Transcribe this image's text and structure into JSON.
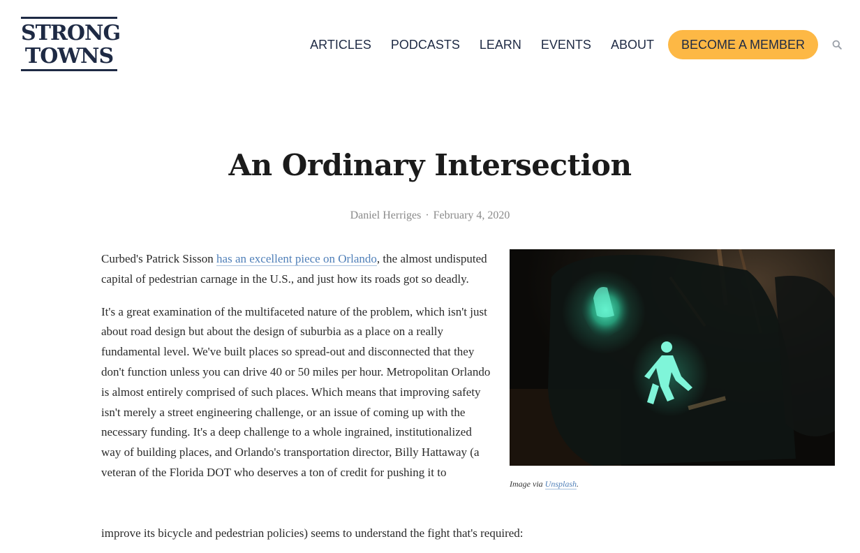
{
  "logo": {
    "line1": "STRONG",
    "line2": "TOWNS"
  },
  "nav": {
    "items": [
      "ARTICLES",
      "PODCASTS",
      "LEARN",
      "EVENTS",
      "ABOUT"
    ],
    "cta": "BECOME A MEMBER",
    "search_icon": "search-icon",
    "cta_color": "#fdb845",
    "brand_color": "#1e2a44"
  },
  "article": {
    "title": "An Ordinary Intersection",
    "author": "Daniel Herriges",
    "separator": "·",
    "date": "February 4, 2020",
    "para1_prefix": "Curbed's Patrick Sisson ",
    "para1_link": "has an excellent piece on Orlando",
    "para1_suffix": ", the almost undisputed capital of pedestrian carnage in the U.S., and just how its roads got so deadly.",
    "para2": "It's a great examination of the multifaceted nature of the problem, which isn't just about road design but about the design of suburbia as a place on a really fundamental level. We've built places so spread-out and disconnected that they don't function unless you can drive 40 or 50 miles per hour. Metropolitan Orlando is almost entirely comprised of such places. Which means that improving safety isn't merely a street engineering challenge, or an issue of coming up with the necessary funding. It's a deep challenge to a whole ingrained, institutionalized way of building places, and Orlando's transportation director, Billy Hattaway (a veteran of the Florida DOT who deserves a ton of credit for pushing it to",
    "para2_last_line": "improve its bicycle and pedestrian policies) seems to understand the fight that's required:",
    "link_color": "#4f7fb8"
  },
  "image": {
    "caption_prefix": "Image via ",
    "caption_link": "Unsplash",
    "caption_suffix": "."
  }
}
